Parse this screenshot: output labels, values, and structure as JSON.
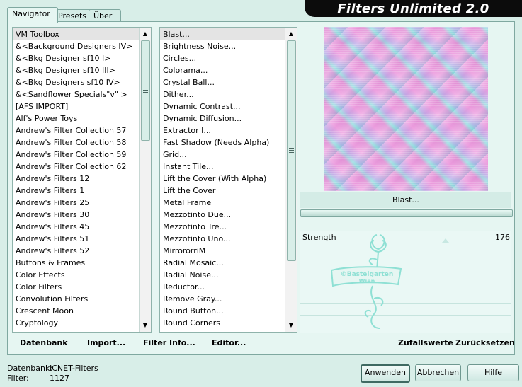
{
  "app_title": "Filters Unlimited 2.0",
  "tabs": [
    {
      "label": "Navigator"
    },
    {
      "label": "Presets"
    },
    {
      "label": "Über"
    }
  ],
  "categories": [
    "VM Toolbox",
    "&<Background Designers IV>",
    "&<Bkg Designer sf10 I>",
    "&<Bkg Designer sf10 III>",
    "&<Bkg Designers sf10 IV>",
    "&<Sandflower Specials\"v\" >",
    "[AFS IMPORT]",
    "Alf's Power Toys",
    "Andrew's Filter Collection 57",
    "Andrew's Filter Collection 58",
    "Andrew's Filter Collection 59",
    "Andrew's Filter Collection 62",
    "Andrew's Filters 12",
    "Andrew's Filters 1",
    "Andrew's Filters 25",
    "Andrew's Filters 30",
    "Andrew's Filters 45",
    "Andrew's Filters 51",
    "Andrew's Filters 52",
    "Buttons & Frames",
    "Color Effects",
    "Color Filters",
    "Convolution Filters",
    "Crescent Moon",
    "Cryptology"
  ],
  "filters": [
    "Blast...",
    "Brightness Noise...",
    "Circles...",
    "Colorama...",
    "Crystal Ball...",
    "Dither...",
    "Dynamic Contrast...",
    "Dynamic Diffusion...",
    "Extractor I...",
    "Fast Shadow (Needs Alpha)",
    "Grid...",
    "Instant Tile...",
    "Lift the Cover (With Alpha)",
    "Lift the Cover",
    "Metal Frame",
    "Mezzotinto Due...",
    "Mezzotinto Tre...",
    "Mezzotinto Uno...",
    "MirrororriM",
    "Radial Mosaic...",
    "Radial Noise...",
    "Reductor...",
    "Remove Gray...",
    "Round Button...",
    "Round Corners"
  ],
  "bottom_buttons": {
    "database": "Datenbank",
    "import": "Import...",
    "filter_info": "Filter Info...",
    "editor": "Editor..."
  },
  "preview": {
    "filter_name": "Blast...",
    "param_label": "Strength",
    "param_value": "176",
    "random_label": "Zufallswerte",
    "reset_label": "Zurücksetzen",
    "watermark_text_1": "©Basteigarten",
    "watermark_text_2": "Wien"
  },
  "status": {
    "db_label": "Datenbank:",
    "db_value": "ICNET-Filters",
    "filter_label": "Filter:",
    "filter_value": "1127"
  },
  "dialog_buttons": {
    "apply": "Anwenden",
    "cancel": "Abbrechen",
    "help": "Hilfe"
  },
  "colors": {
    "background": "#d8eee8",
    "panel": "#e6f6f2",
    "title_banner": "#0c0c0c",
    "preview_pink": "#f2b6e8",
    "preview_cyan": "#a8e6e6"
  }
}
